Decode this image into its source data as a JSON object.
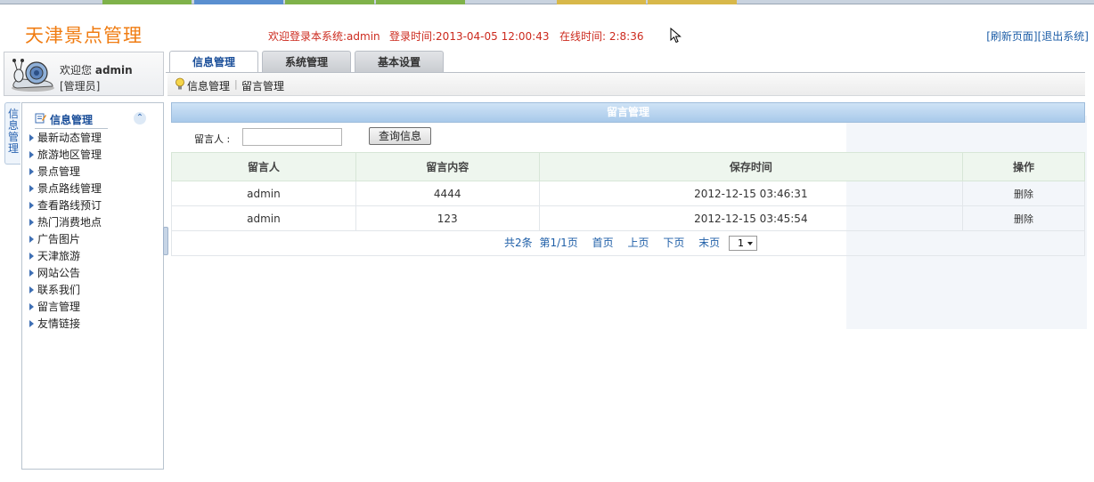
{
  "header": {
    "logo": "天津景点管理",
    "welcome_system": "欢迎登录本系统:admin",
    "login_time": "登录时间:2013-04-05 12:00:43",
    "online_time": "在线时间: 2:8:36",
    "refresh_link": "[刷新页面]",
    "logout_link": "[退出系统]"
  },
  "user": {
    "welcome_prefix": "欢迎您",
    "name": "admin",
    "role": "[管理员]"
  },
  "tabs": [
    {
      "label": "信息管理",
      "active": true
    },
    {
      "label": "系统管理",
      "active": false
    },
    {
      "label": "基本设置",
      "active": false
    }
  ],
  "breadcrumb": {
    "first": "信息管理",
    "separator": "|",
    "second": "留言管理"
  },
  "sidebar": {
    "vertical_tab": "信息管理",
    "title": "信息管理",
    "collapse_icon": "double-chevron-up-icon",
    "items": [
      "最新动态管理",
      "旅游地区管理",
      "景点管理",
      "景点路线管理",
      "查看路线预订",
      "热门消费地点",
      "广告图片",
      "天津旅游",
      "网站公告",
      "联系我们",
      "留言管理",
      "友情链接"
    ]
  },
  "panel": {
    "title": "留言管理",
    "filter_label": "留言人 :",
    "filter_value": "",
    "search_button": "查询信息"
  },
  "table": {
    "columns": [
      "留言人",
      "留言内容",
      "保存时间",
      "操作"
    ],
    "rows": [
      {
        "author": "admin",
        "content": "4444",
        "time": "2012-12-15 03:46:31",
        "action": "删除"
      },
      {
        "author": "admin",
        "content": "123",
        "time": "2012-12-15 03:45:54",
        "action": "删除"
      }
    ]
  },
  "pager": {
    "total": "共2条",
    "page": "第1/1页",
    "first": "首页",
    "prev": "上页",
    "next": "下页",
    "last": "末页",
    "selected": "1"
  },
  "colors": {
    "logo": "#f07c12",
    "header_info": "#cc2a1e",
    "link": "#1f5fa8",
    "panel_header": "#a8c9ea",
    "table_header_bg": "#eef6ee"
  }
}
